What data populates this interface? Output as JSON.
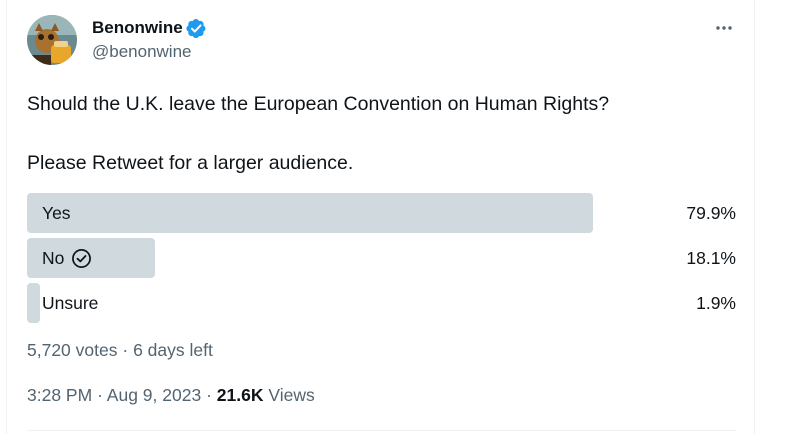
{
  "author": {
    "display_name": "Benonwine",
    "handle": "@benonwine",
    "verified": true,
    "avatar_icon": "avatar-icon"
  },
  "tweet": {
    "line1": "Should the U.K. leave the European Convention on Human Rights?",
    "line2": "Please Retweet for a larger audience."
  },
  "poll": {
    "options": [
      {
        "label": "Yes",
        "percent_label": "79.9%",
        "fraction": 0.799,
        "selected": false
      },
      {
        "label": "No",
        "percent_label": "18.1%",
        "fraction": 0.181,
        "selected": true
      },
      {
        "label": "Unsure",
        "percent_label": "1.9%",
        "fraction": 0.019,
        "selected": false
      }
    ],
    "votes": "5,720 votes",
    "separator": "·",
    "time_left": "6 days left"
  },
  "meta": {
    "time": "3:28 PM",
    "separator1": "·",
    "date": "Aug 9, 2023",
    "separator2": "·",
    "views_count": "21.6K",
    "views_label": "Views"
  },
  "colors": {
    "bar": "#cfd9de",
    "verified_blue": "#1d9bf0",
    "secondary_text": "#536471",
    "primary_text": "#0f1419"
  }
}
